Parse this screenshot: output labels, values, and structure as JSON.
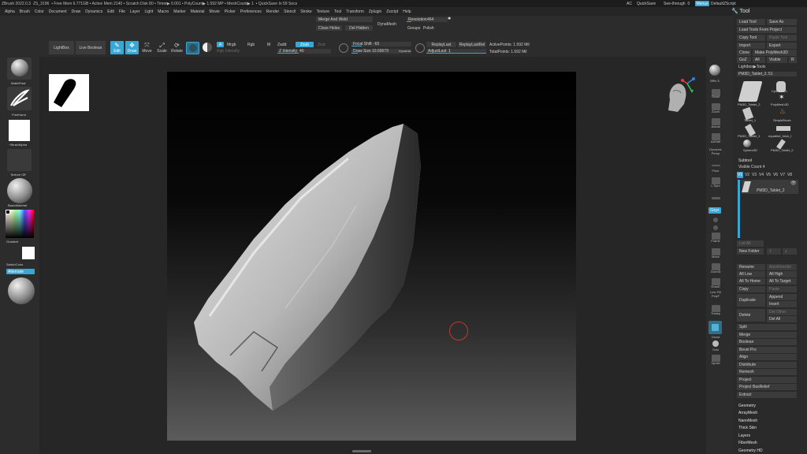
{
  "titlebar": {
    "segments": [
      "ZBrush 2022.0.3",
      "ZS_3196",
      "• Free Mem 6.771GB • Active Mem 2140 • Scratch Disk 80 • Timer▶ 0.001 • PolyCount▶ 1.592 MP • MeshCount▶ 1",
      "• QuickSave In 59 Secs"
    ],
    "ac": "AC",
    "quicksave": "QuickSave",
    "seethrough": "See-through",
    "seethrough_value": "0",
    "menus": "Menus",
    "default_script": "DefaultZScript"
  },
  "menubar": [
    "Alpha",
    "Brush",
    "Color",
    "Document",
    "Draw",
    "Dynamics",
    "Edit",
    "File",
    "Layer",
    "Light",
    "Macro",
    "Marker",
    "Material",
    "Movie",
    "Picker",
    "Preferences",
    "Render",
    "Stencil",
    "Stroke",
    "Texture",
    "Tool",
    "Transform",
    "Zplugin",
    "Zscript",
    "Help"
  ],
  "topshelf": {
    "merge_and_weld": "Merge And Weld",
    "dynamesh": "DynaMesh",
    "resolution_label": "Resolution",
    "resolution_value": "464",
    "resolution_fill": 0.12,
    "close_holes": "Close Holes",
    "del_hidden": "Del Hidden",
    "groups": "Groups",
    "polish": "Polish",
    "lightbox": "LightBox",
    "live_boolean": "Live Boolean",
    "edit": "Edit",
    "draw": "Draw",
    "move": "Move",
    "scale": "Scale",
    "rotate": "Rotate",
    "a_btn": "A",
    "mrgb": "Mrgb",
    "rgb": "Rgb",
    "m": "M",
    "zadd": "Zadd",
    "zsub": "Zsub",
    "zcut": "Zcut",
    "rgb_intensity": "Rgb Intensity",
    "z_intensity_label": "Z Intensity",
    "z_intensity_value": "40",
    "z_intensity_fill": 0.4,
    "focal_shift_label": "Focal Shift",
    "focal_shift_value": "-65",
    "focal_shift_fill": 0.17,
    "draw_size_label": "Draw Size",
    "draw_size_value": "10.69679",
    "draw_size_fill": 0.1,
    "dynamic": "Dynamic",
    "replay_last": "ReplayLast",
    "replay_last_rel": "ReplayLastRel",
    "adjust_last_label": "AdjustLast",
    "adjust_last_value": "1",
    "adjust_last_fill": 1.0,
    "active_points": "ActivePoints: 1.592 Mil",
    "total_points": "TotalPoints: 1.592 Mil"
  },
  "leftshelf": {
    "brush": "MalletFast",
    "stroke": "FreeHand",
    "alpha": "~BrushAlpha",
    "texture": "Texture Off",
    "material": "BasicMaterial",
    "gradient": "Gradient",
    "switch_color": "SwitchColor",
    "alternate": "Alternate"
  },
  "rightshelf": {
    "spix_label": "SPix",
    "spix_value": "3",
    "items": [
      "Scroll",
      "Zoom",
      "Actual",
      "AAHalf",
      "Dynamic Persp",
      "Floor",
      "L.Sym",
      "Gxyz",
      "",
      "",
      "Frame",
      "Move",
      "ZoomD",
      "RotaD",
      "Line Fill PolyF",
      "Transp",
      "Ghost",
      "Solo",
      "Xpose"
    ]
  },
  "panel": {
    "title": "Tool",
    "load_tool": "Load Tool",
    "save_as": "Save As",
    "load_tools_from_project": "Load Tools From Project",
    "copy_tool": "Copy Tool",
    "paste_tool": "Paste Tool",
    "import": "Import",
    "export": "Export",
    "clone": "Clone",
    "make_polymesh3d": "Make PolyMesh3D",
    "goz": "GoZ",
    "all": "All",
    "visible": "Visible",
    "r": "R",
    "lightbox_tools": "Lightbox▶Tools",
    "current_tool_label": "PM3D_Tablet_2.",
    "current_tool_value": "51",
    "thumbs": [
      "PM3D_Tablet_2",
      "Cylinder3D",
      "PolyMesh3D",
      "Tablet_1",
      "SimpleBrush",
      "PM3D_Tablet_1",
      "equablot_brick_f",
      "Sphere3D",
      "PM3D_Tablet_2"
    ],
    "subtool": "Subtool",
    "visible_count_label": "Visible Count",
    "visible_count_value": "4",
    "versions": [
      "V1",
      "V2",
      "V3",
      "V4",
      "V5",
      "V6",
      "V7",
      "V8"
    ],
    "subtool_item": "PM3D_Tablet_2",
    "list_all": "List All",
    "new_folder": "New Folder",
    "rename": "Rename",
    "autoreorder": "AutoReorder",
    "all_low": "All Low",
    "all_high": "All High",
    "all_to_home": "All To Home",
    "all_to_target": "All To Target",
    "copy": "Copy",
    "paste": "Paste",
    "duplicate": "Duplicate",
    "append": "Append",
    "insert": "Insert",
    "delete": "Delete",
    "del_other": "Del Other",
    "del_all": "Del All",
    "menu_items": [
      "Split",
      "Merge",
      "Boolean",
      "Bevel Pro",
      "Align",
      "Distribute",
      "Remesh",
      "Project",
      "Project BasRelief",
      "Extract"
    ],
    "sub_sections": [
      "Geometry",
      "ArrayMesh",
      "NanoMesh",
      "Thick Skin",
      "Layers",
      "FiberMesh",
      "Geometry HD"
    ]
  },
  "colors": {
    "accent": "#39a7d6",
    "panel_bg": "#2a2a2a",
    "button_bg": "#3b3b3b",
    "cursor_ring": "#c0392b"
  }
}
